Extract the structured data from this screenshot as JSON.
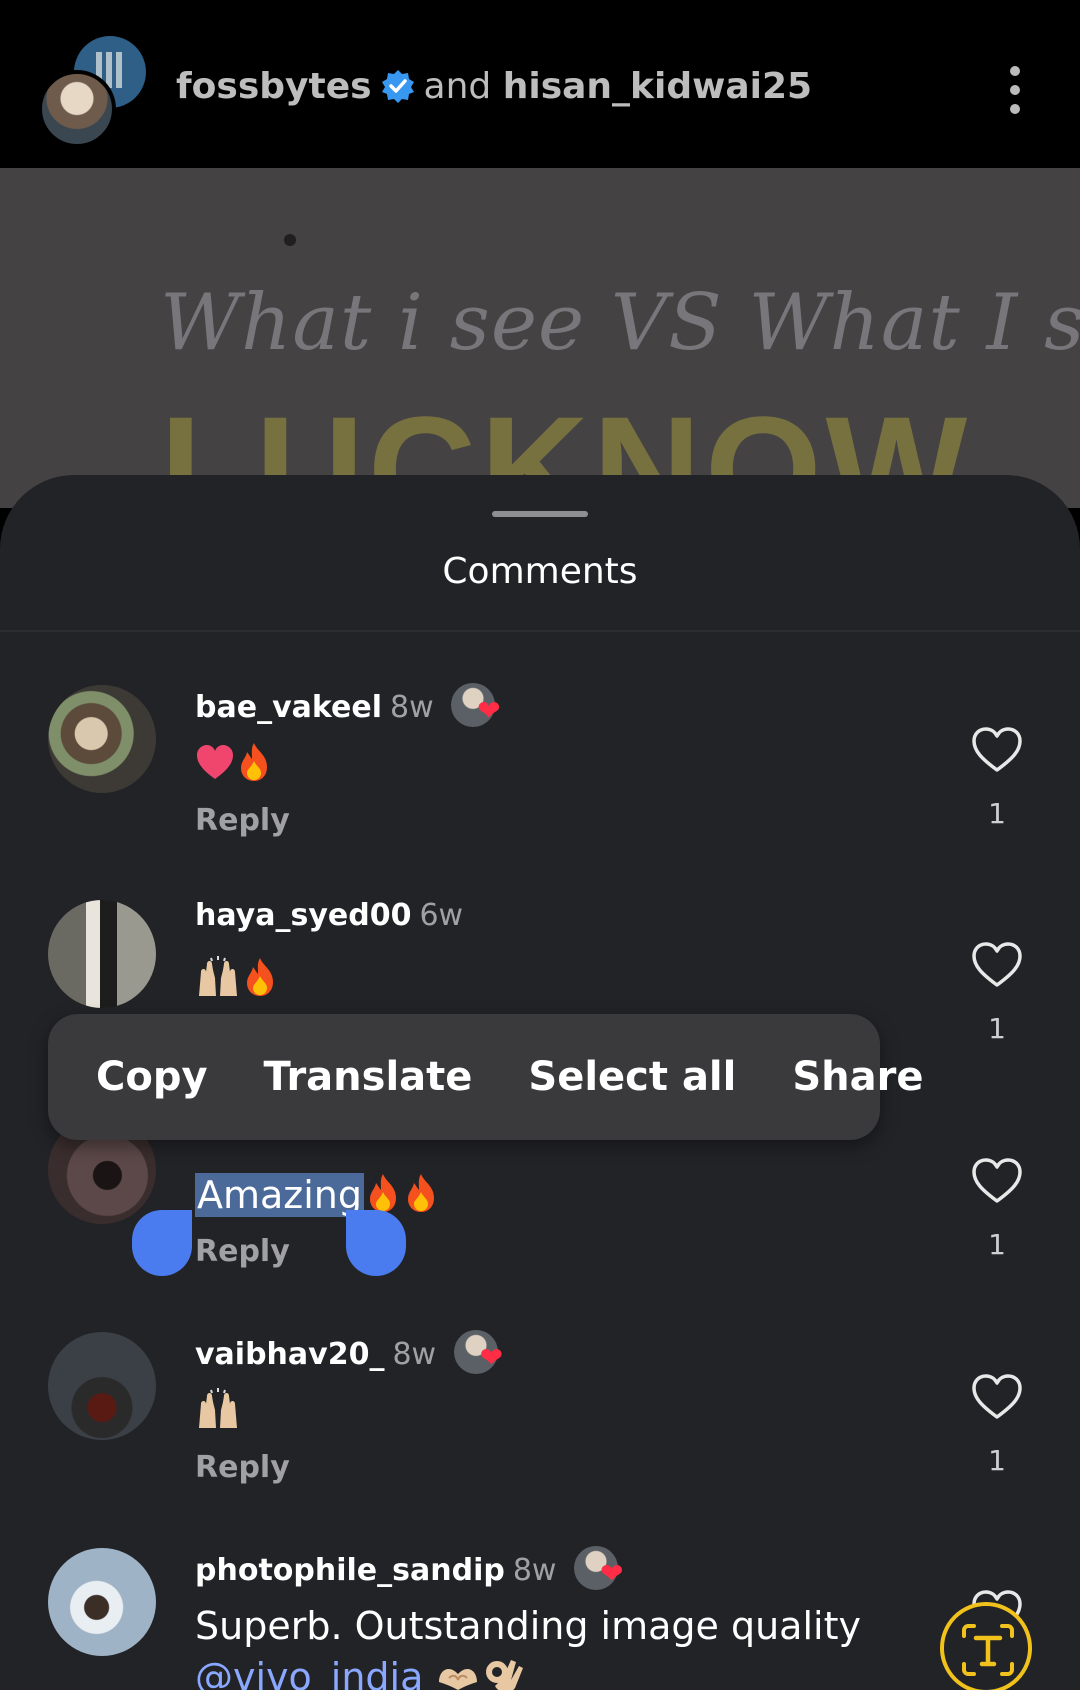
{
  "header": {
    "owner_primary": "fossbytes",
    "joiner": "and",
    "owner_secondary": "hisan_kidwai25",
    "menu_icon": "more-vertical-icon"
  },
  "post": {
    "caption_script": "What i see VS What I shot",
    "caption_big": "LUCKNOW"
  },
  "sheet": {
    "title": "Comments"
  },
  "comments": [
    {
      "user": "bae_vakeel",
      "time": "8w",
      "text": "",
      "reply": "Reply",
      "likes": "1",
      "emojis": [
        "heart",
        "fire"
      ],
      "author_liked": true
    },
    {
      "user": "haya_syed00",
      "time": "6w",
      "text": "",
      "reply": "",
      "likes": "1",
      "emojis": [
        "raising-hands",
        "fire"
      ],
      "author_liked": false
    },
    {
      "user": "",
      "time": "",
      "text": "Amazing",
      "reply": "Reply",
      "likes": "1",
      "emojis": [
        "fire",
        "fire"
      ],
      "author_liked": false
    },
    {
      "user": "vaibhav20_",
      "time": "8w",
      "text": "",
      "reply": "Reply",
      "likes": "1",
      "emojis": [
        "raising-hands"
      ],
      "author_liked": true
    },
    {
      "user": "photophile_sandip",
      "time": "8w",
      "text": "Superb. Outstanding image quality",
      "mention": "@vivo_india",
      "reply": "",
      "likes": "",
      "emojis": [
        "heart-hands",
        "ok-hand"
      ],
      "author_liked": true
    }
  ],
  "context_menu": {
    "items": [
      "Copy",
      "Translate",
      "Select all",
      "Share"
    ]
  },
  "colors": {
    "sheet_bg": "#222327",
    "selection": "#4b6a9a",
    "handle": "#4a7cf0",
    "mention": "#8aa8ff",
    "accent_ring": "#f1c21b",
    "verified": "#3897f0"
  }
}
